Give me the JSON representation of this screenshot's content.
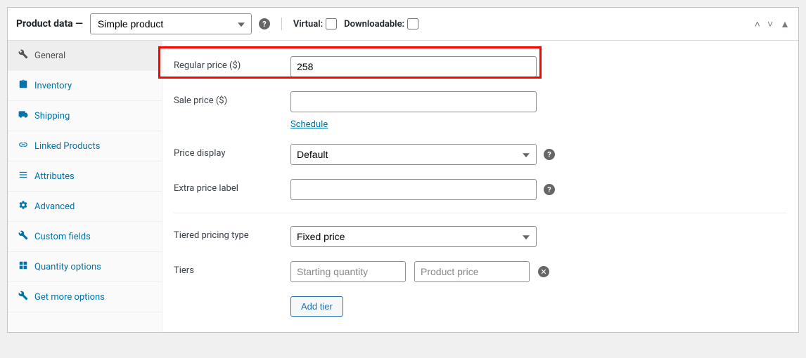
{
  "header": {
    "title": "Product data —",
    "product_type": "Simple product",
    "virtual_label": "Virtual:",
    "downloadable_label": "Downloadable:"
  },
  "sidebar": {
    "items": [
      {
        "label": "General"
      },
      {
        "label": "Inventory"
      },
      {
        "label": "Shipping"
      },
      {
        "label": "Linked Products"
      },
      {
        "label": "Attributes"
      },
      {
        "label": "Advanced"
      },
      {
        "label": "Custom fields"
      },
      {
        "label": "Quantity options"
      },
      {
        "label": "Get more options"
      }
    ]
  },
  "form": {
    "regular_price_label": "Regular price ($)",
    "regular_price_value": "258",
    "sale_price_label": "Sale price ($)",
    "sale_price_value": "",
    "schedule_link": "Schedule",
    "price_display_label": "Price display",
    "price_display_value": "Default",
    "extra_price_label": "Extra price label",
    "extra_price_value": "",
    "tiered_type_label": "Tiered pricing type",
    "tiered_type_value": "Fixed price",
    "tiers_label": "Tiers",
    "tier_qty_placeholder": "Starting quantity",
    "tier_price_placeholder": "Product price",
    "add_tier_button": "Add tier"
  }
}
